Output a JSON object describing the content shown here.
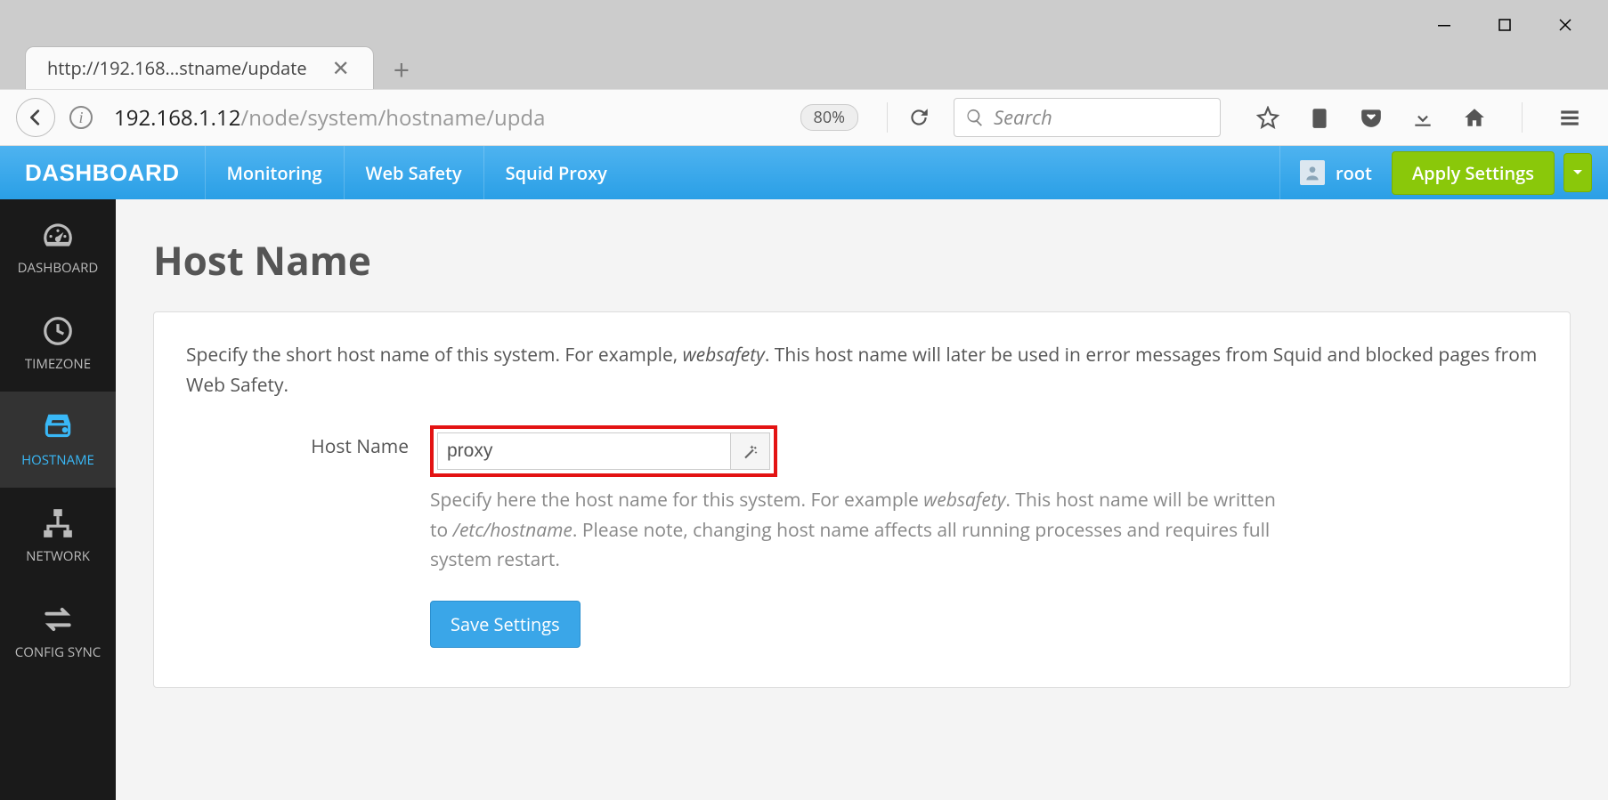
{
  "browser": {
    "tab_title": "http://192.168...stname/update",
    "url_dark": "192.168.1.12",
    "url_path": "/node/system/hostname/upda",
    "zoom": "80%",
    "search_placeholder": "Search"
  },
  "topnav": {
    "brand": "DASHBOARD",
    "items": [
      "Monitoring",
      "Web Safety",
      "Squid Proxy"
    ],
    "user": "root",
    "apply_label": "Apply Settings"
  },
  "sidebar": {
    "items": [
      {
        "label": "DASHBOARD",
        "icon": "gauge"
      },
      {
        "label": "TIMEZONE",
        "icon": "clock"
      },
      {
        "label": "HOSTNAME",
        "icon": "drive",
        "active": true
      },
      {
        "label": "NETWORK",
        "icon": "sitemap"
      },
      {
        "label": "CONFIG SYNC",
        "icon": "exchange"
      }
    ]
  },
  "page": {
    "title": "Host Name",
    "desc_pre": "Specify the short host name of this system. For example, ",
    "desc_em": "websafety",
    "desc_post": ". This host name will later be used in error messages from Squid and blocked pages from Web Safety.",
    "field_label": "Host Name",
    "field_value": "proxy",
    "help_pre": "Specify here the host name for this system. For example ",
    "help_em1": "websafety",
    "help_mid": ". This host name will be written to ",
    "help_em2": "/etc/hostname",
    "help_post": ". Please note, changing host name affects all running processes and requires full system restart.",
    "save_label": "Save Settings"
  }
}
